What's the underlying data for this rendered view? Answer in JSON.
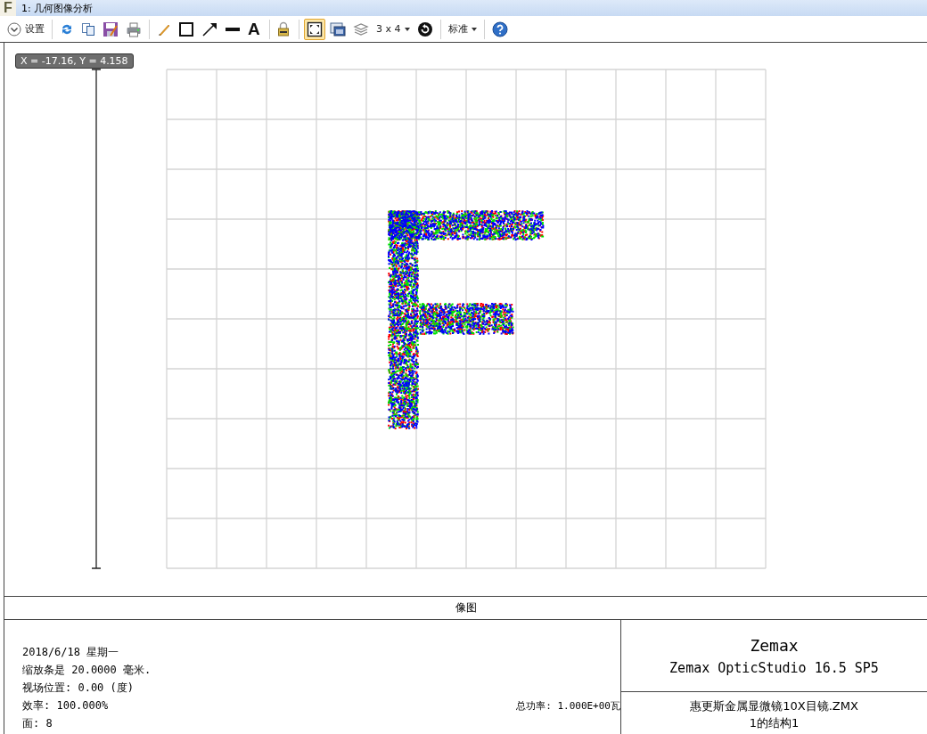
{
  "window": {
    "app_glyph": "F",
    "title": "1: 几何图像分析"
  },
  "toolbar": {
    "groups": [
      [
        {
          "kind": "settings",
          "label": "设置",
          "selected": false
        }
      ],
      [
        {
          "kind": "refresh",
          "selected": false
        },
        {
          "kind": "copy",
          "selected": false
        },
        {
          "kind": "save",
          "selected": false
        },
        {
          "kind": "print",
          "selected": false
        }
      ],
      [
        {
          "kind": "pencil",
          "selected": false
        },
        {
          "kind": "rectangle",
          "selected": false
        },
        {
          "kind": "arrow",
          "selected": false
        },
        {
          "kind": "line",
          "selected": false
        },
        {
          "kind": "text",
          "label": "A",
          "selected": false
        }
      ],
      [
        {
          "kind": "lock",
          "selected": false
        }
      ],
      [
        {
          "kind": "fit",
          "selected": true
        },
        {
          "kind": "window",
          "selected": false
        },
        {
          "kind": "layers",
          "selected": false
        },
        {
          "kind": "dropdown",
          "label": "3 x 4",
          "selected": false
        },
        {
          "kind": "rotate",
          "selected": false
        }
      ],
      [
        {
          "kind": "dropdown",
          "label": "标准",
          "selected": false
        }
      ],
      [
        {
          "kind": "help",
          "selected": false
        }
      ]
    ]
  },
  "plot": {
    "tooltip": "X = -17.16, Y = 4.158",
    "caption": "像图"
  },
  "info": {
    "lines": [
      "2018/6/18 星期一",
      "缩放条是 20.0000 毫米.",
      "视场位置: 0.00 (度)",
      "效率: 100.000%",
      "面: 8"
    ],
    "total_power": "总功率: 1.000E+00瓦"
  },
  "title_block": {
    "company": "Zemax",
    "product": "Zemax OpticStudio 16.5 SP5",
    "file": "惠更斯金属显微镜10X目镜.ZMX",
    "config": "1的结构1"
  }
}
